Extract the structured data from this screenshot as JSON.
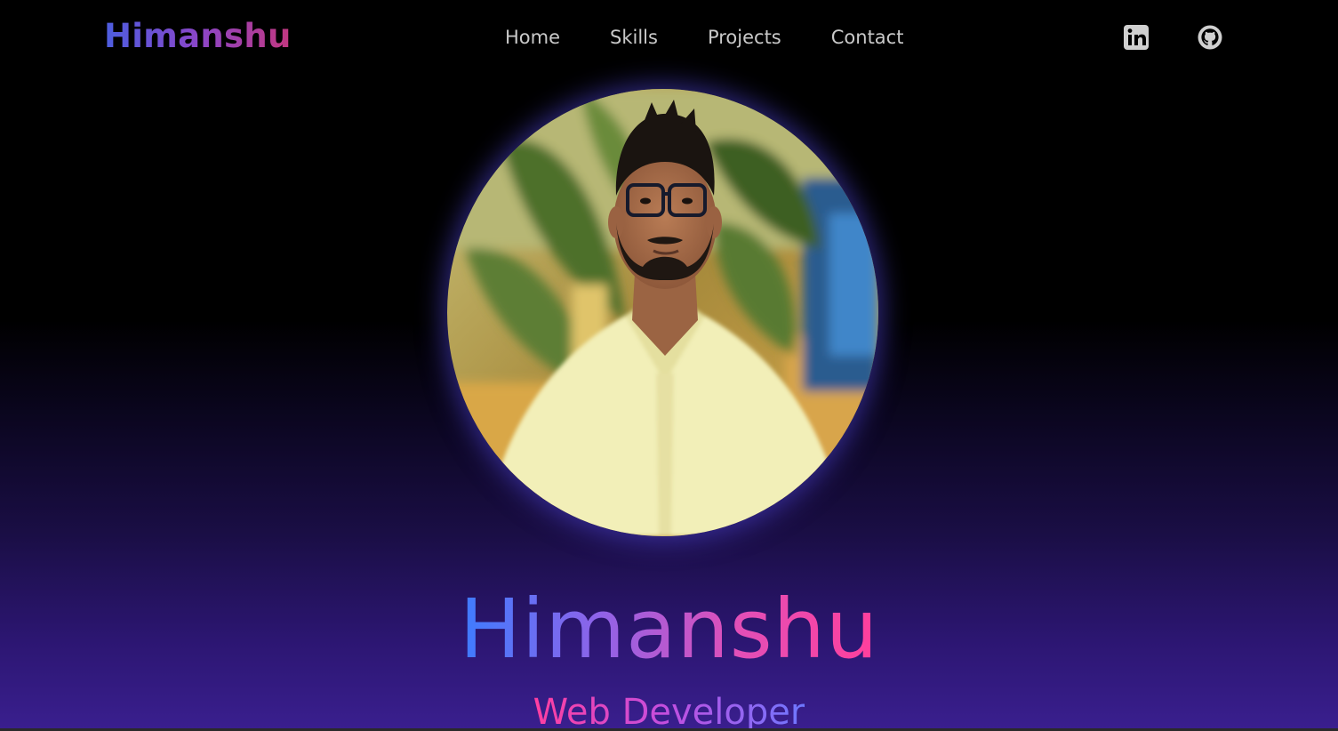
{
  "header": {
    "logo": "Himanshu",
    "nav": [
      {
        "label": "Home"
      },
      {
        "label": "Skills"
      },
      {
        "label": "Projects"
      },
      {
        "label": "Contact"
      }
    ],
    "social": [
      {
        "icon": "linkedin-icon"
      },
      {
        "icon": "github-icon"
      }
    ]
  },
  "hero": {
    "avatar_icon": "profile-photo",
    "name": "Himanshu",
    "role": "Web Developer"
  },
  "colors": {
    "background": "#000000",
    "gradient_bottom": "#3a1f8f",
    "nav_text": "#c9c9c9",
    "accent_blue": "#3d7cff",
    "accent_pink": "#ff3f9c"
  }
}
